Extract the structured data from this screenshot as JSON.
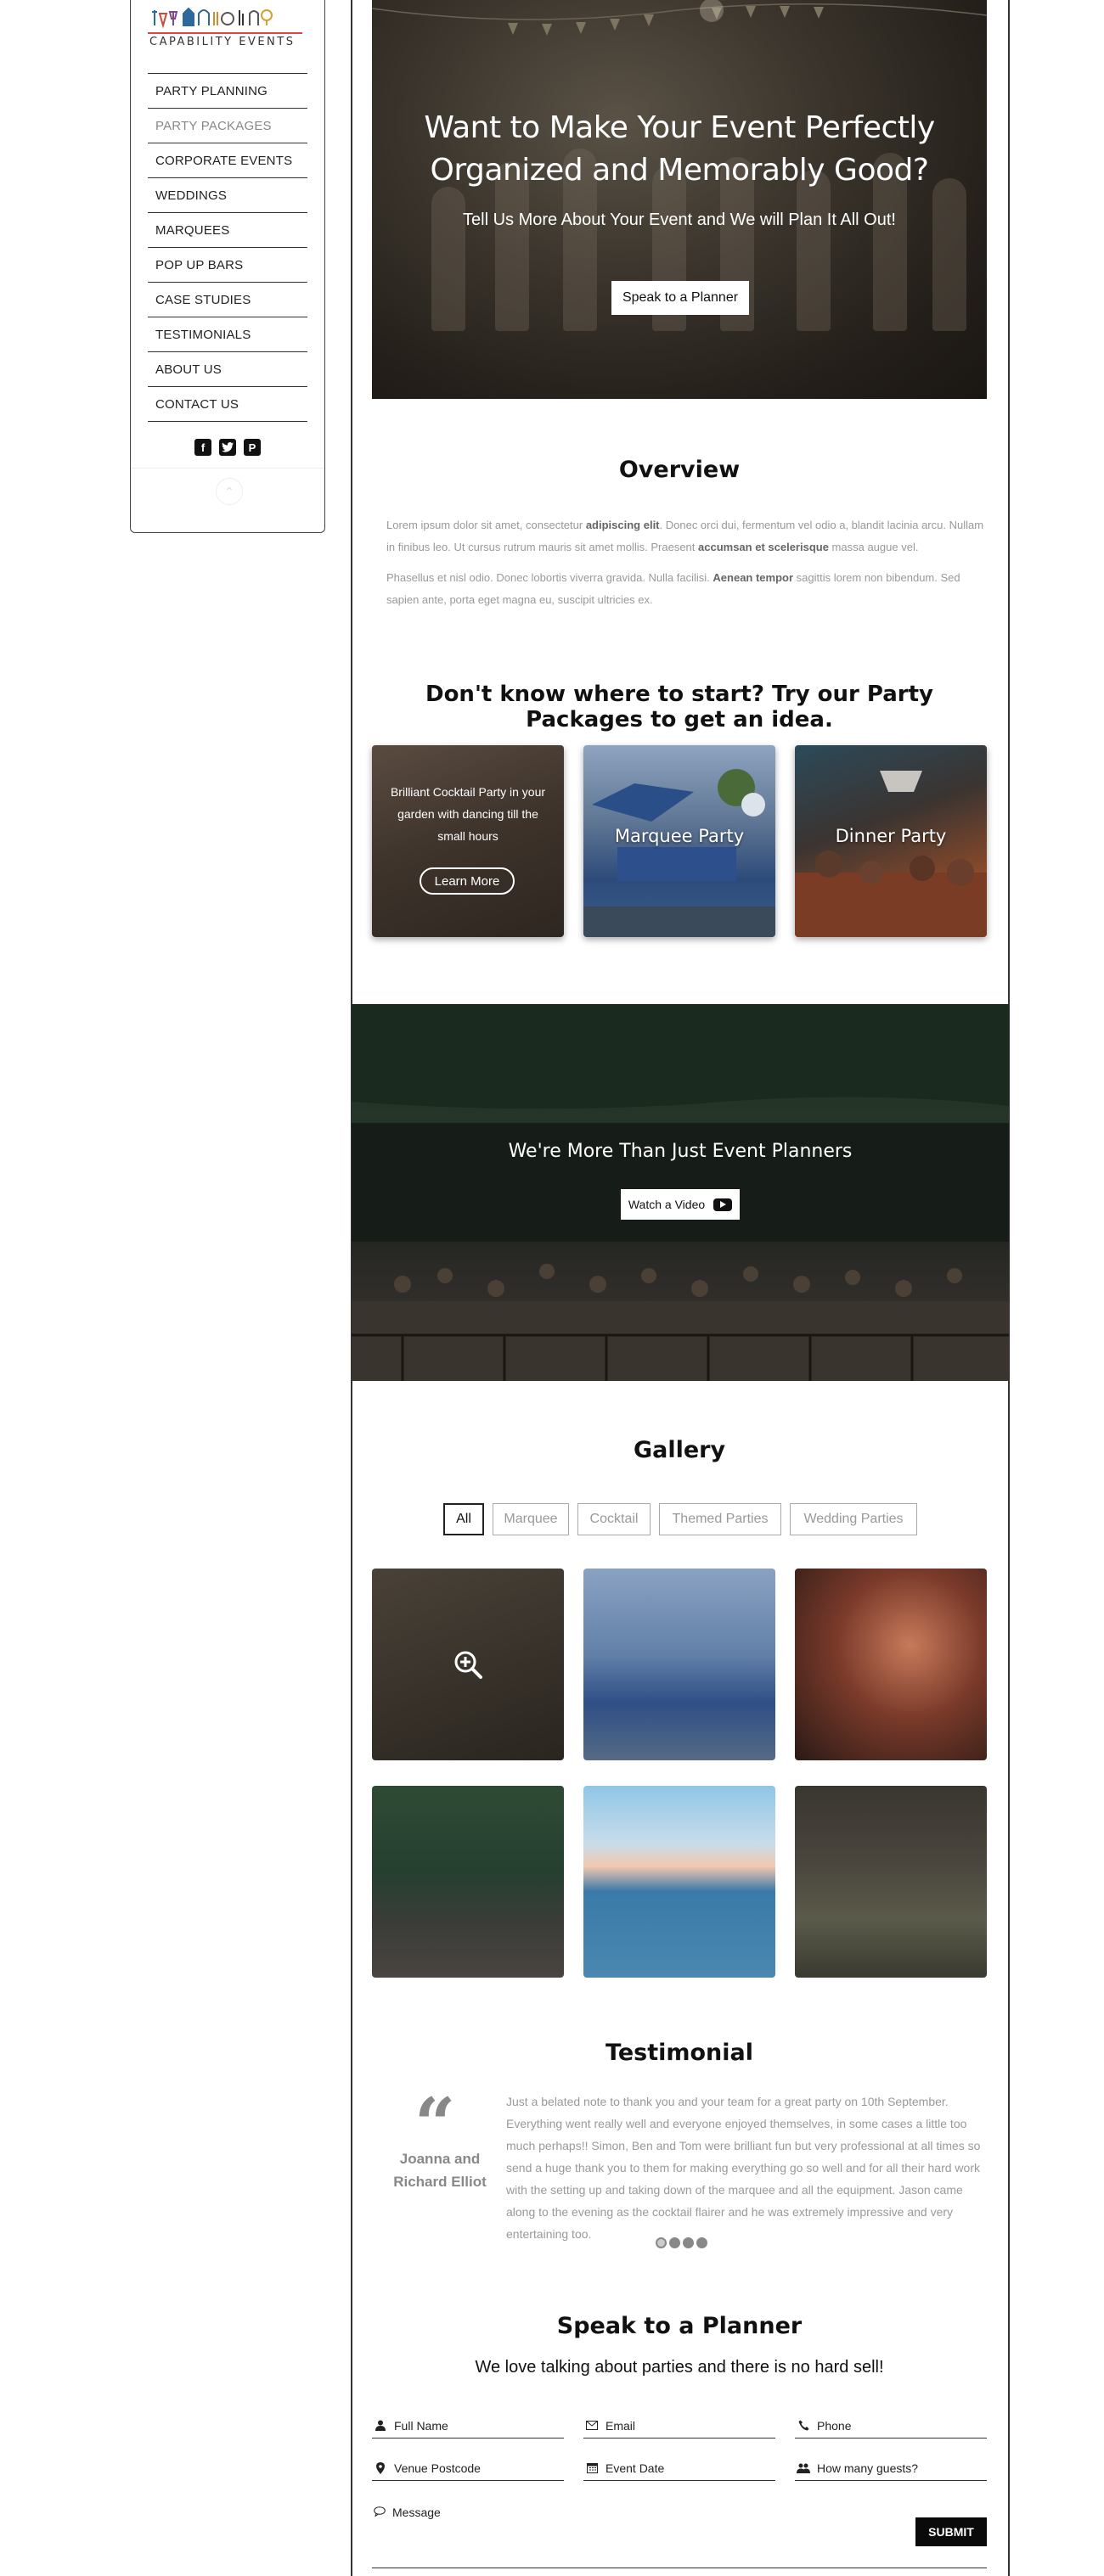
{
  "brand": {
    "logo_text": "CAPABILITY EVENTS"
  },
  "sidebar": {
    "items": [
      {
        "label": "PARTY PLANNING",
        "active": false
      },
      {
        "label": "PARTY PACKAGES",
        "active": true
      },
      {
        "label": "CORPORATE EVENTS",
        "active": false
      },
      {
        "label": "WEDDINGS",
        "active": false
      },
      {
        "label": "MARQUEES",
        "active": false
      },
      {
        "label": "POP UP BARS",
        "active": false
      },
      {
        "label": "CASE STUDIES",
        "active": false
      },
      {
        "label": "TESTIMONIALS",
        "active": false
      },
      {
        "label": "ABOUT US",
        "active": false
      },
      {
        "label": "CONTACT US",
        "active": false
      }
    ],
    "social_icons": [
      "facebook-icon",
      "twitter-icon",
      "pinterest-icon"
    ]
  },
  "hero": {
    "title_line1": "Want to Make Your Event Perfectly",
    "title_line2": "Organized and Memorably Good?",
    "subtitle": "Tell Us More About Your Event and We will Plan It All Out!",
    "button_label": "Speak to a Planner"
  },
  "overview": {
    "title": "Overview",
    "p1_a": "Lorem ipsum dolor sit amet, consectetur ",
    "p1_b": "adipiscing elit",
    "p1_c": ". Donec orci dui, fermentum vel odio a, blandit lacinia arcu. Nullam in finibus leo. Ut cursus rutrum mauris sit amet mollis. Praesent ",
    "p1_d": "accumsan et scelerisque",
    "p1_e": " massa augue vel.",
    "p2_a": "Phasellus et nisl odio. Donec lobortis viverra gravida. Nulla facilisi. ",
    "p2_b": "Aenean tempor",
    "p2_c": " sagittis lorem non bibendum. Sed sapien ante, porta eget magna eu, suscipit ultricies ex."
  },
  "packages": {
    "title": "Don't know where to start? Try our Party Packages to get an idea.",
    "cards": [
      {
        "text": "Brilliant Cocktail Party in your garden with dancing till the small hours",
        "button": "Learn More"
      },
      {
        "label": "Marquee Party"
      },
      {
        "label": "Dinner Party"
      }
    ]
  },
  "video": {
    "title": "We're More Than Just Event Planners",
    "button_label": "Watch a Video"
  },
  "gallery": {
    "title": "Gallery",
    "filters": [
      "All",
      "Marquee",
      "Cocktail",
      "Themed Parties",
      "Wedding Parties"
    ],
    "active_filter": "All"
  },
  "testimonial": {
    "title": "Testimonial",
    "name_line1": "Joanna and",
    "name_line2": "Richard Elliot",
    "text": "Just a belated note to thank you and your team for a great party on 10th September. Everything went really well and everyone enjoyed themselves, in some cases a little too much perhaps!! Simon, Ben and Tom were brilliant fun but very professional at all times so send a huge thank you to them for making everything go so well and for all their hard work with the setting up and taking down of the marquee and all the equipment. Jason came along to the evening as the cocktail flairer and he was extremely impressive and very entertaining too.",
    "slide_count": 4,
    "active_slide": 0
  },
  "contact": {
    "title": "Speak to a Planner",
    "subtitle": "We love talking about parties and there is no hard sell!",
    "fields": {
      "full_name": "Full Name",
      "email": "Email",
      "phone": "Phone",
      "venue_postcode": "Venue Postcode",
      "event_date": "Event Date",
      "guests": "How many guests?",
      "message": "Message"
    },
    "submit_label": "SUBMIT"
  }
}
